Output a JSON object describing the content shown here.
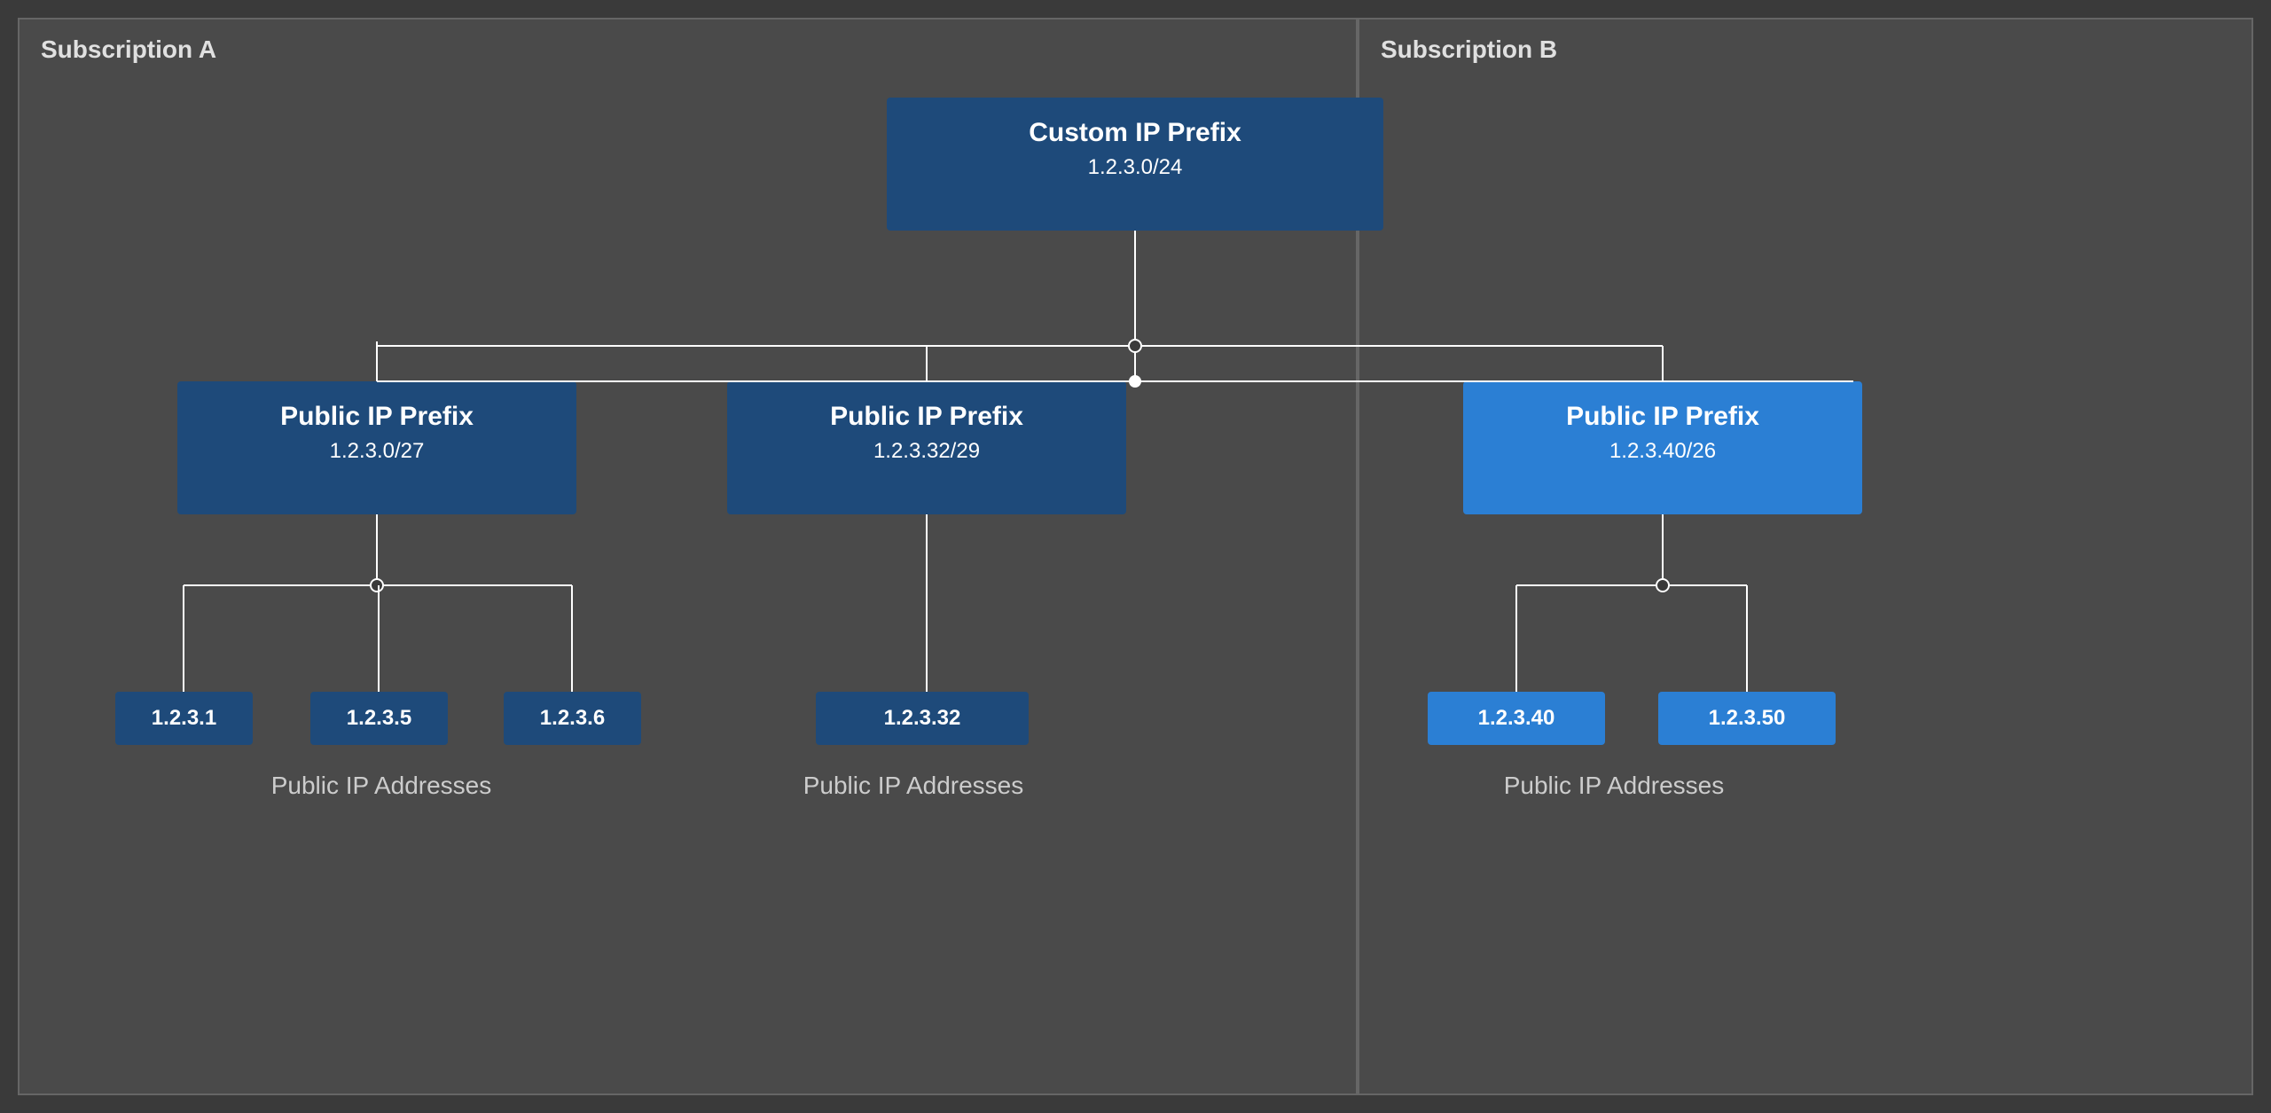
{
  "subscriptions": {
    "a": {
      "label": "Subscription A"
    },
    "b": {
      "label": "Subscription B"
    }
  },
  "customIPPrefix": {
    "title": "Custom IP Prefix",
    "subnet": "1.2.3.0/24"
  },
  "publicIPPrefixes": [
    {
      "id": "prefix-a1",
      "title": "Public IP Prefix",
      "subnet": "1.2.3.0/27",
      "bright": false
    },
    {
      "id": "prefix-a2",
      "title": "Public IP Prefix",
      "subnet": "1.2.3.32/29",
      "bright": false
    },
    {
      "id": "prefix-b1",
      "title": "Public IP Prefix",
      "subnet": "1.2.3.40/26",
      "bright": true
    }
  ],
  "publicIPs": {
    "group1": {
      "addresses": [
        "1.2.3.1",
        "1.2.3.5",
        "1.2.3.6"
      ],
      "label": "Public IP Addresses",
      "bright": false
    },
    "group2": {
      "addresses": [
        "1.2.3.32"
      ],
      "label": "Public IP Addresses",
      "bright": false
    },
    "group3": {
      "addresses": [
        "1.2.3.40",
        "1.2.3.50"
      ],
      "label": "Public IP Addresses",
      "bright": true
    }
  }
}
